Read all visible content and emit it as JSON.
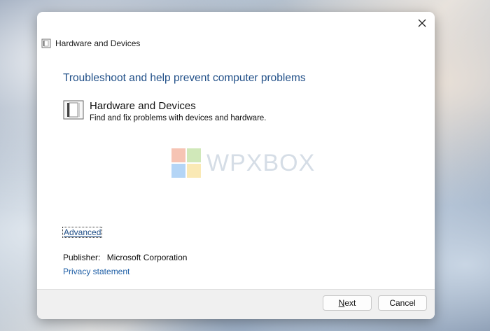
{
  "window": {
    "title": "Hardware and Devices",
    "close_icon": "close-icon"
  },
  "main": {
    "heading": "Troubleshoot and help prevent computer problems",
    "item": {
      "icon": "hardware-devices-icon",
      "title": "Hardware and Devices",
      "description": "Find and fix problems with devices and hardware."
    },
    "watermark": "WPXBOX",
    "advanced_link": "Advanced",
    "publisher_label": "Publisher:",
    "publisher_value": "Microsoft Corporation",
    "privacy_link": "Privacy statement"
  },
  "footer": {
    "next_first": "N",
    "next_rest": "ext",
    "cancel_label": "Cancel"
  },
  "colors": {
    "heading": "#1f4e87",
    "link": "#1f5fa6",
    "footer_bg": "#f0f0f0"
  }
}
